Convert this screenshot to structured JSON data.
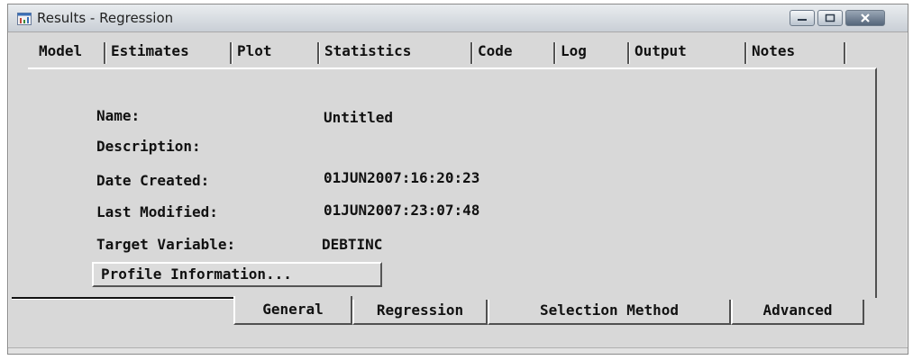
{
  "window": {
    "title": "Results - Regression"
  },
  "top_tabs": [
    {
      "label": "Model"
    },
    {
      "label": "Estimates"
    },
    {
      "label": "Plot"
    },
    {
      "label": "Statistics"
    },
    {
      "label": "Code"
    },
    {
      "label": "Log"
    },
    {
      "label": "Output"
    },
    {
      "label": "Notes"
    }
  ],
  "general": {
    "name_label": "Name:",
    "name_value": "Untitled",
    "description_label": "Description:",
    "description_value": "",
    "date_created_label": "Date Created:",
    "date_created_value": "01JUN2007:16:20:23",
    "last_modified_label": "Last Modified:",
    "last_modified_value": "01JUN2007:23:07:48",
    "target_variable_label": "Target Variable:",
    "target_variable_value": "DEBTINC",
    "profile_button": "Profile Information..."
  },
  "bottom_tabs": [
    {
      "label": "General"
    },
    {
      "label": "Regression"
    },
    {
      "label": "Selection Method"
    },
    {
      "label": "Advanced"
    }
  ],
  "icons": {
    "app": "results-window-icon",
    "minimize": "minimize-icon",
    "maximize": "maximize-icon",
    "close": "close-icon"
  },
  "colors": {
    "window_bg": "#d8d8d8",
    "close_button": "#55667a"
  }
}
